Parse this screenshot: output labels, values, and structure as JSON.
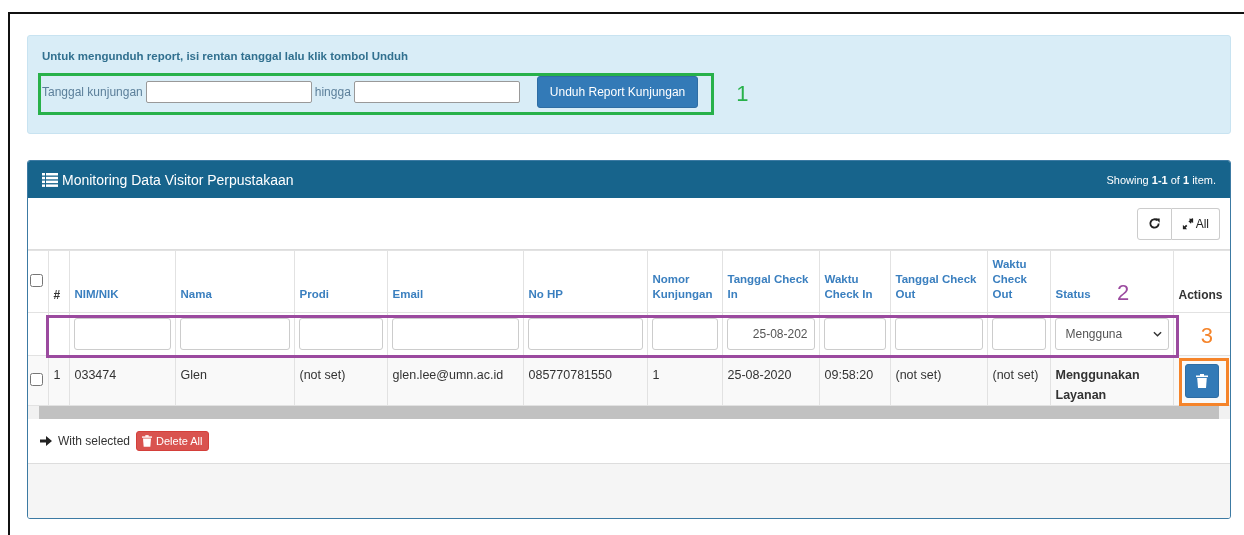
{
  "download_alert": {
    "title": "Untuk mengunduh report, isi rentan tanggal lalu klik tombol Unduh",
    "from_label": "Tanggal kunjungan",
    "to_label": "hingga",
    "button": "Unduh Report Kunjungan"
  },
  "panel": {
    "title": "Monitoring Data Visitor Perpustakaan",
    "summary": "Showing **1-1** of **1** item.",
    "toolbar": {
      "all_button": "All"
    }
  },
  "table": {
    "select_all": {
      "checked": false
    },
    "columns": [
      {
        "label": "#",
        "kind": "plain"
      },
      {
        "label": "NIM/NIK",
        "kind": "link"
      },
      {
        "label": "Nama",
        "kind": "link"
      },
      {
        "label": "Prodi",
        "kind": "link"
      },
      {
        "label": "Email",
        "kind": "link"
      },
      {
        "label": "No HP",
        "kind": "link"
      },
      {
        "label": "Nomor Kunjungan",
        "kind": "link"
      },
      {
        "label": "Tanggal Check In",
        "kind": "link"
      },
      {
        "label": "Waktu Check In",
        "kind": "link"
      },
      {
        "label": "Tanggal Check Out",
        "kind": "link"
      },
      {
        "label": "Waktu Check Out",
        "kind": "link"
      },
      {
        "label": "Status",
        "kind": "link"
      },
      {
        "label": "Actions",
        "kind": "plain"
      }
    ],
    "filters": [
      {
        "kind": "none"
      },
      {
        "kind": "text"
      },
      {
        "kind": "text"
      },
      {
        "kind": "text"
      },
      {
        "kind": "text"
      },
      {
        "kind": "text"
      },
      {
        "kind": "text"
      },
      {
        "kind": "text",
        "value": "25-08-202"
      },
      {
        "kind": "text"
      },
      {
        "kind": "text"
      },
      {
        "kind": "text"
      },
      {
        "kind": "select",
        "value": "Mengguna"
      },
      {
        "kind": "none"
      }
    ],
    "rows": [
      {
        "checked": false,
        "cells": [
          "1",
          "033474",
          "Glen",
          "(not set)",
          "glen.lee@umn.ac.id",
          "085770781550",
          "1",
          "25-08-2020",
          "09:58:20",
          "(not set)",
          "(not set)",
          "Menggunakan Layanan"
        ]
      }
    ]
  },
  "footer": {
    "label": "With selected",
    "button": "Delete All"
  },
  "annotations": [
    {
      "label": "1",
      "color": "#28b14a",
      "kind": "form"
    },
    {
      "label": "2",
      "color": "#9b4a9f",
      "kind": "filters"
    },
    {
      "label": "3",
      "color": "#f5842a",
      "kind": "action"
    }
  ]
}
